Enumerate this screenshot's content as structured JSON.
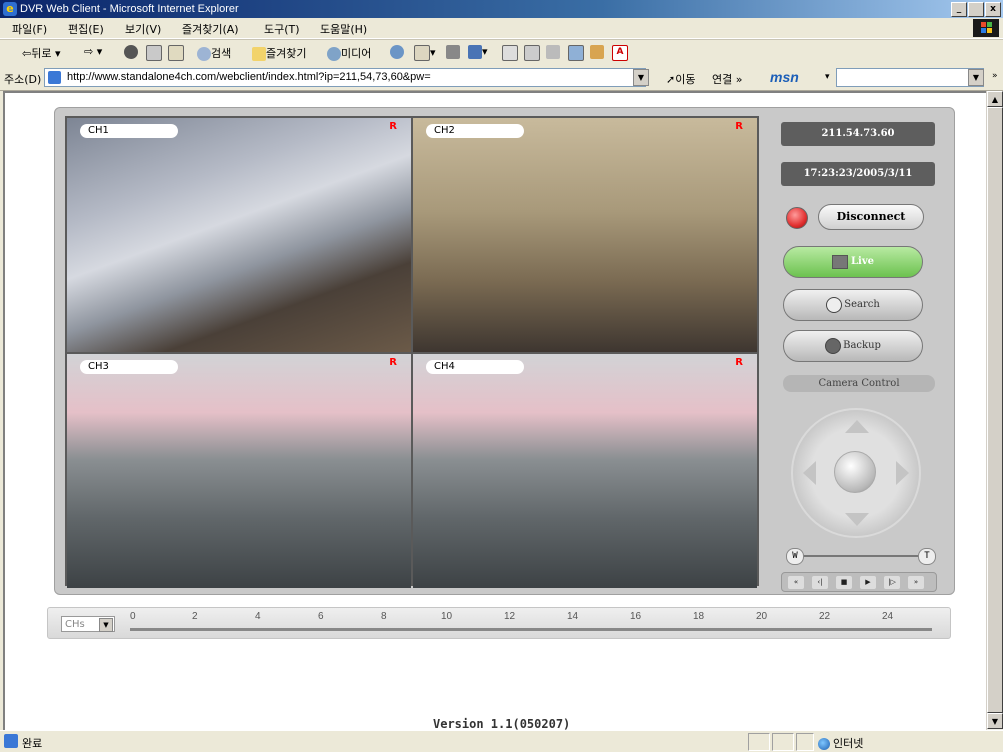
{
  "window": {
    "title": "DVR Web Client - Microsoft Internet Explorer",
    "min": "_",
    "max": " ",
    "close": "x"
  },
  "menu": [
    "파일(F)",
    "편집(E)",
    "보기(V)",
    "즐겨찾기(A)",
    "도구(T)",
    "도움말(H)"
  ],
  "toolbar": {
    "back": "뒤로",
    "search": "검색",
    "favorites": "즐겨찾기",
    "media": "미디어"
  },
  "address": {
    "label": "주소(D)",
    "url": "http://www.standalone4ch.com/webclient/index.html?ip=211,54,73,60&pw=",
    "go": "이동",
    "links": "연결 »",
    "msn": "msn"
  },
  "dvr": {
    "ip": "211.54.73.60",
    "datetime": "17:23:23/2005/3/11",
    "disconnect": "Disconnect",
    "modes": {
      "live": "Live",
      "search": "Search",
      "backup": "Backup"
    },
    "camera_control": "Camera Control",
    "zoom_w": "W",
    "zoom_t": "T",
    "playback": [
      "«",
      "‹|",
      "■",
      "▶",
      "|▷",
      "»"
    ],
    "channels": [
      {
        "label": "CH1",
        "rec": "R"
      },
      {
        "label": "CH2",
        "rec": "R"
      },
      {
        "label": "CH3",
        "rec": "R"
      },
      {
        "label": "CH4",
        "rec": "R"
      }
    ]
  },
  "timeline": {
    "select": "CHs",
    "ticks": [
      "0",
      "2",
      "4",
      "6",
      "8",
      "10",
      "12",
      "14",
      "16",
      "18",
      "20",
      "22",
      "24"
    ]
  },
  "version": "Version 1.1(050207)",
  "status": {
    "text": "완료",
    "zone": "인터넷"
  }
}
